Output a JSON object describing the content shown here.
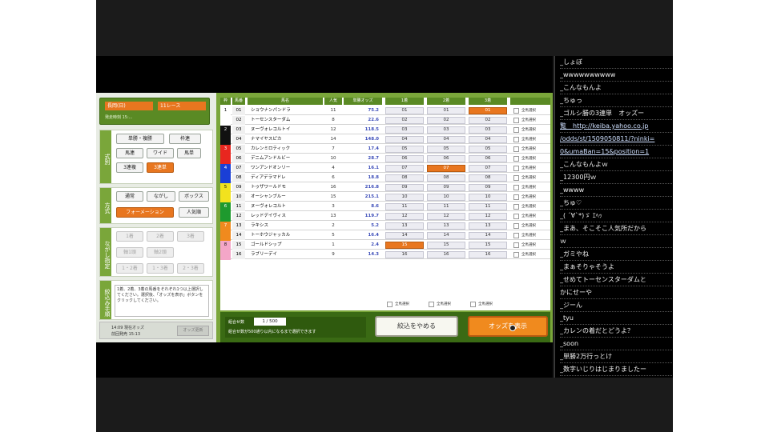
{
  "header": {
    "date": "長岡(日)",
    "race": "11レース",
    "info": "発走時刻 15:..."
  },
  "method": {
    "title": "式別",
    "buttons": [
      "単勝・複勝",
      "枠連",
      "馬連",
      "ワイド",
      "馬単",
      "3連複",
      "3連単"
    ],
    "selected": "3連単"
  },
  "style": {
    "title": "方式",
    "buttons": [
      "通常",
      "ながし",
      "ボックス",
      "フォーメーション",
      "人気順"
    ],
    "selected": "フォーメーション"
  },
  "axis": {
    "title": "ながし指定",
    "buttons": [
      "1着",
      "2着",
      "3着",
      "軸1頭",
      "軸2頭",
      "1・2着",
      "1・3着",
      "2・3着"
    ]
  },
  "filter": {
    "title": "絞込み手順",
    "note": "1着、2着、3着の馬番をそれぞれ1つ以上選択してください。選択後、「オッズを表示」ボタンをクリックしてください。"
  },
  "footer": {
    "time": "14:09 現在オッズ",
    "updated": "前回発売 15:13",
    "button": "オッズ更新"
  },
  "table": {
    "headers": [
      "枠",
      "馬番",
      "馬名",
      "人気",
      "単勝オッズ",
      "1着",
      "2着",
      "3着",
      ""
    ],
    "rows": [
      {
        "frame": "1",
        "num": "01",
        "name": "ショウナンパンドラ",
        "pop": "11",
        "odds": "75.2"
      },
      {
        "frame": "",
        "num": "02",
        "name": "トーセンスターダム",
        "pop": "8",
        "odds": "22.6"
      },
      {
        "frame": "2",
        "num": "03",
        "name": "ヌーヴォレコルトイ",
        "pop": "12",
        "odds": "118.5"
      },
      {
        "frame": "",
        "num": "04",
        "name": "ナマイヤスピカ",
        "pop": "14",
        "odds": "148.0"
      },
      {
        "frame": "3",
        "num": "05",
        "name": "カレンミロティック",
        "pop": "7",
        "odds": "17.4"
      },
      {
        "frame": "",
        "num": "06",
        "name": "デニムアンドルビー",
        "pop": "10",
        "odds": "28.7"
      },
      {
        "frame": "4",
        "num": "07",
        "name": "ワンアンドオンリー",
        "pop": "4",
        "odds": "16.1"
      },
      {
        "frame": "",
        "num": "08",
        "name": "ディアデラマドレ",
        "pop": "6",
        "odds": "18.8"
      },
      {
        "frame": "5",
        "num": "09",
        "name": "トゥザワールドモ",
        "pop": "16",
        "odds": "216.8"
      },
      {
        "frame": "",
        "num": "10",
        "name": "オーシャンブルー",
        "pop": "15",
        "odds": "215.1"
      },
      {
        "frame": "6",
        "num": "11",
        "name": "ヌーヴォレコルト",
        "pop": "3",
        "odds": "8.6"
      },
      {
        "frame": "",
        "num": "12",
        "name": "レッドデイヴィス",
        "pop": "13",
        "odds": "119.7"
      },
      {
        "frame": "7",
        "num": "13",
        "name": "ラキシス",
        "pop": "2",
        "odds": "5.2"
      },
      {
        "frame": "",
        "num": "14",
        "name": "トーホウジャッカル",
        "pop": "5",
        "odds": "16.4"
      },
      {
        "frame": "8",
        "num": "15",
        "name": "ゴールドシップ",
        "pop": "1",
        "odds": "2.4"
      },
      {
        "frame": "",
        "num": "16",
        "name": "ラブリーデイ",
        "pop": "9",
        "odds": "14.3"
      }
    ],
    "exclude_label": "全馬選択",
    "col_exclude": "全馬選択"
  },
  "bottom": {
    "count_label": "組合せ数",
    "count": "1 / 500",
    "note": "組合せ数が500通り以内になるまで選択できます",
    "cancel": "絞込をやめる",
    "show": "オッズを表示"
  },
  "chat": [
    "_しょぼ",
    "_wwwwwwwwww",
    "_こんなもんよ",
    "_ちゅっ",
    "_ゴルシ勝の3連単　オッズー",
    "覧　http://keiba.yahoo.co.jp",
    "/odds/st/1509050811/?ninki=",
    "0&umaBan=15&position=1",
    "_こんなもんよｗ",
    "_12300円ｗ",
    "_wwww",
    "_ちゅ♡",
    "_(  ´∀`*)ゞ  ｴﾍｯ",
    "_まあ、そこそこ人気所だから",
    "ｗ",
    "_ガミやね",
    "_まぁそりゃそうよ",
    "_せめてトーセンスターダムと",
    "かにせーや",
    "_ジーん",
    "_tyu",
    "_カレンの着だとどうよ？",
    "_soon",
    "_単勝2万行っとけ",
    "_数字いじりはじまりましたー"
  ]
}
